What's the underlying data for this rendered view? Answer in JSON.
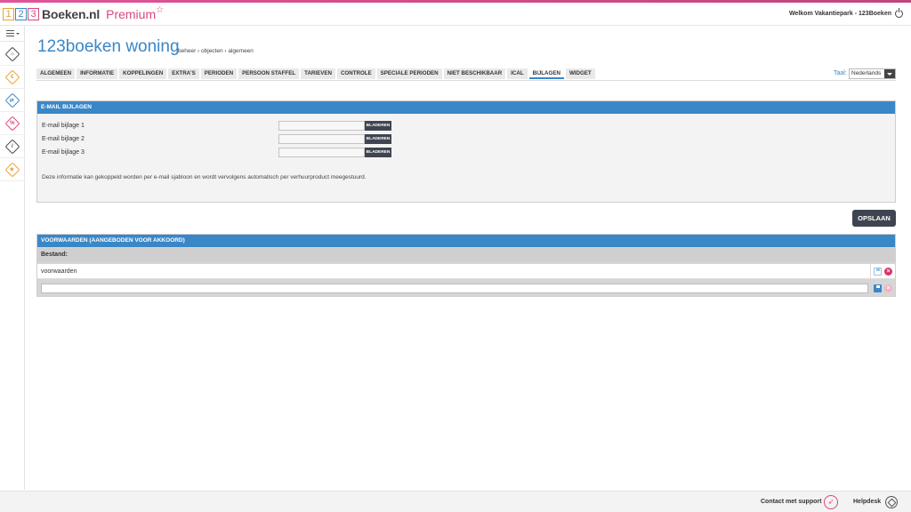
{
  "header": {
    "logo_digits": [
      "1",
      "2",
      "3"
    ],
    "brand": "Boeken.nl",
    "premium": "Premium",
    "welcome": "Welkom Vakantiepark - 123Boeken"
  },
  "sidebar": {
    "items": [
      {
        "icon": "home-diamond-icon",
        "glyph": "⌂",
        "color": "#444444"
      },
      {
        "icon": "euro-diamond-icon",
        "glyph": "€",
        "color": "#e3a23b"
      },
      {
        "icon": "arrows-diamond-icon",
        "glyph": "⇄",
        "color": "#3a87c8"
      },
      {
        "icon": "percent-diamond-icon",
        "glyph": "%",
        "color": "#d9467e"
      },
      {
        "icon": "ruler-diamond-icon",
        "glyph": "/",
        "color": "#444444"
      },
      {
        "icon": "gear-diamond-icon",
        "glyph": "✱",
        "color": "#e3a23b"
      }
    ]
  },
  "page": {
    "title": "123boeken woning",
    "breadcrumb": "beheer › objecten › algemeen"
  },
  "tabs": [
    {
      "label": "ALGEMEEN",
      "active": false
    },
    {
      "label": "INFORMATIE",
      "active": false
    },
    {
      "label": "KOPPELINGEN",
      "active": false
    },
    {
      "label": "EXTRA'S",
      "active": false
    },
    {
      "label": "PERIODEN",
      "active": false
    },
    {
      "label": "PERSOON STAFFEL",
      "active": false
    },
    {
      "label": "TARIEVEN",
      "active": false
    },
    {
      "label": "CONTROLE",
      "active": false
    },
    {
      "label": "SPECIALE PERIODEN",
      "active": false
    },
    {
      "label": "NIET BESCHIKBAAR",
      "active": false
    },
    {
      "label": "ICAL",
      "active": false
    },
    {
      "label": "BIJLAGEN",
      "active": true
    },
    {
      "label": "WIDGET",
      "active": false
    }
  ],
  "language": {
    "label": "Taal:",
    "selected": "Nederlands"
  },
  "email_attachments": {
    "heading": "E-MAIL BIJLAGEN",
    "rows": [
      {
        "label": "E-mail bijlage 1",
        "button": "BLADEREN"
      },
      {
        "label": "E-mail bijlage 2",
        "button": "BLADEREN"
      },
      {
        "label": "E-mail bijlage 3",
        "button": "BLADEREN"
      }
    ],
    "info": "Deze informatie kan gekoppeld worden per e-mail sjabloon en wordt vervolgens automatisch per verhuurproduct meegestuurd."
  },
  "save_button": "OPSLAAN",
  "conditions": {
    "heading": "VOORWAARDEN (AANGEBODEN VOOR AKKOORD)",
    "column": "Bestand:",
    "file_name": "voorwaarden",
    "new_value": ""
  },
  "footer": {
    "support": "Contact met support",
    "helpdesk": "Helpdesk"
  },
  "colors": {
    "accent_blue": "#3a87c8",
    "brand_pink": "#d9467e",
    "dark_button": "#3f4550"
  }
}
